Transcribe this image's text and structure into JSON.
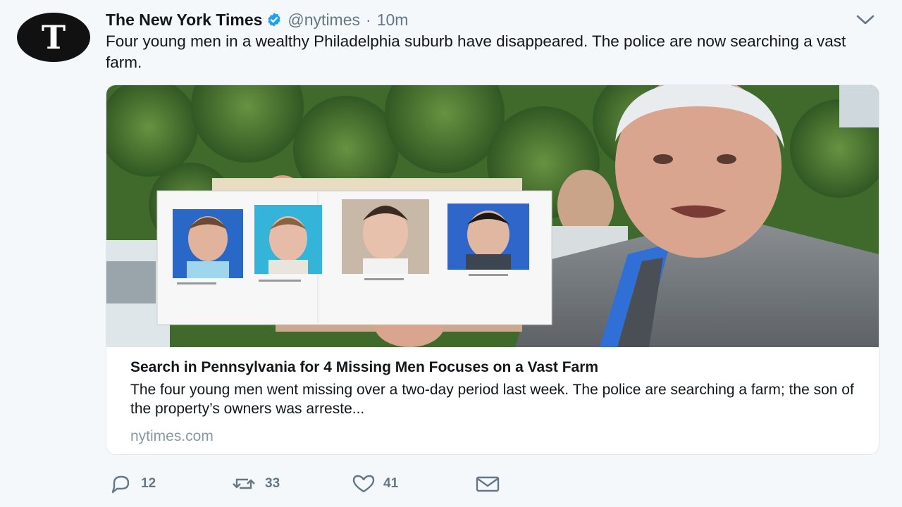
{
  "tweet": {
    "author_name": "The New York Times",
    "handle": "@nytimes",
    "separator": "·",
    "time": "10m",
    "avatar_letter": "T",
    "text": "Four young men in a wealthy Philadelphia suburb have disappeared. The police are now searching a vast farm."
  },
  "card": {
    "title": "Search in Pennsylvania for 4 Missing Men Focuses on a Vast Farm",
    "description": "The four young men went missing over a two-day period last week. The police are searching a farm; the son of the property’s owners was arreste...",
    "domain": "nytimes.com"
  },
  "actions": {
    "replies": "12",
    "retweets": "33",
    "likes": "41"
  },
  "colors": {
    "background": "#f5f8fa",
    "verified_blue": "#1da1f2",
    "muted_text": "#657786",
    "domain_text": "#8899a6"
  },
  "icons": {
    "verified": "verified-badge-icon",
    "caret": "chevron-down-icon",
    "reply": "reply-icon",
    "retweet": "retweet-icon",
    "like": "heart-icon",
    "dm": "envelope-icon"
  }
}
